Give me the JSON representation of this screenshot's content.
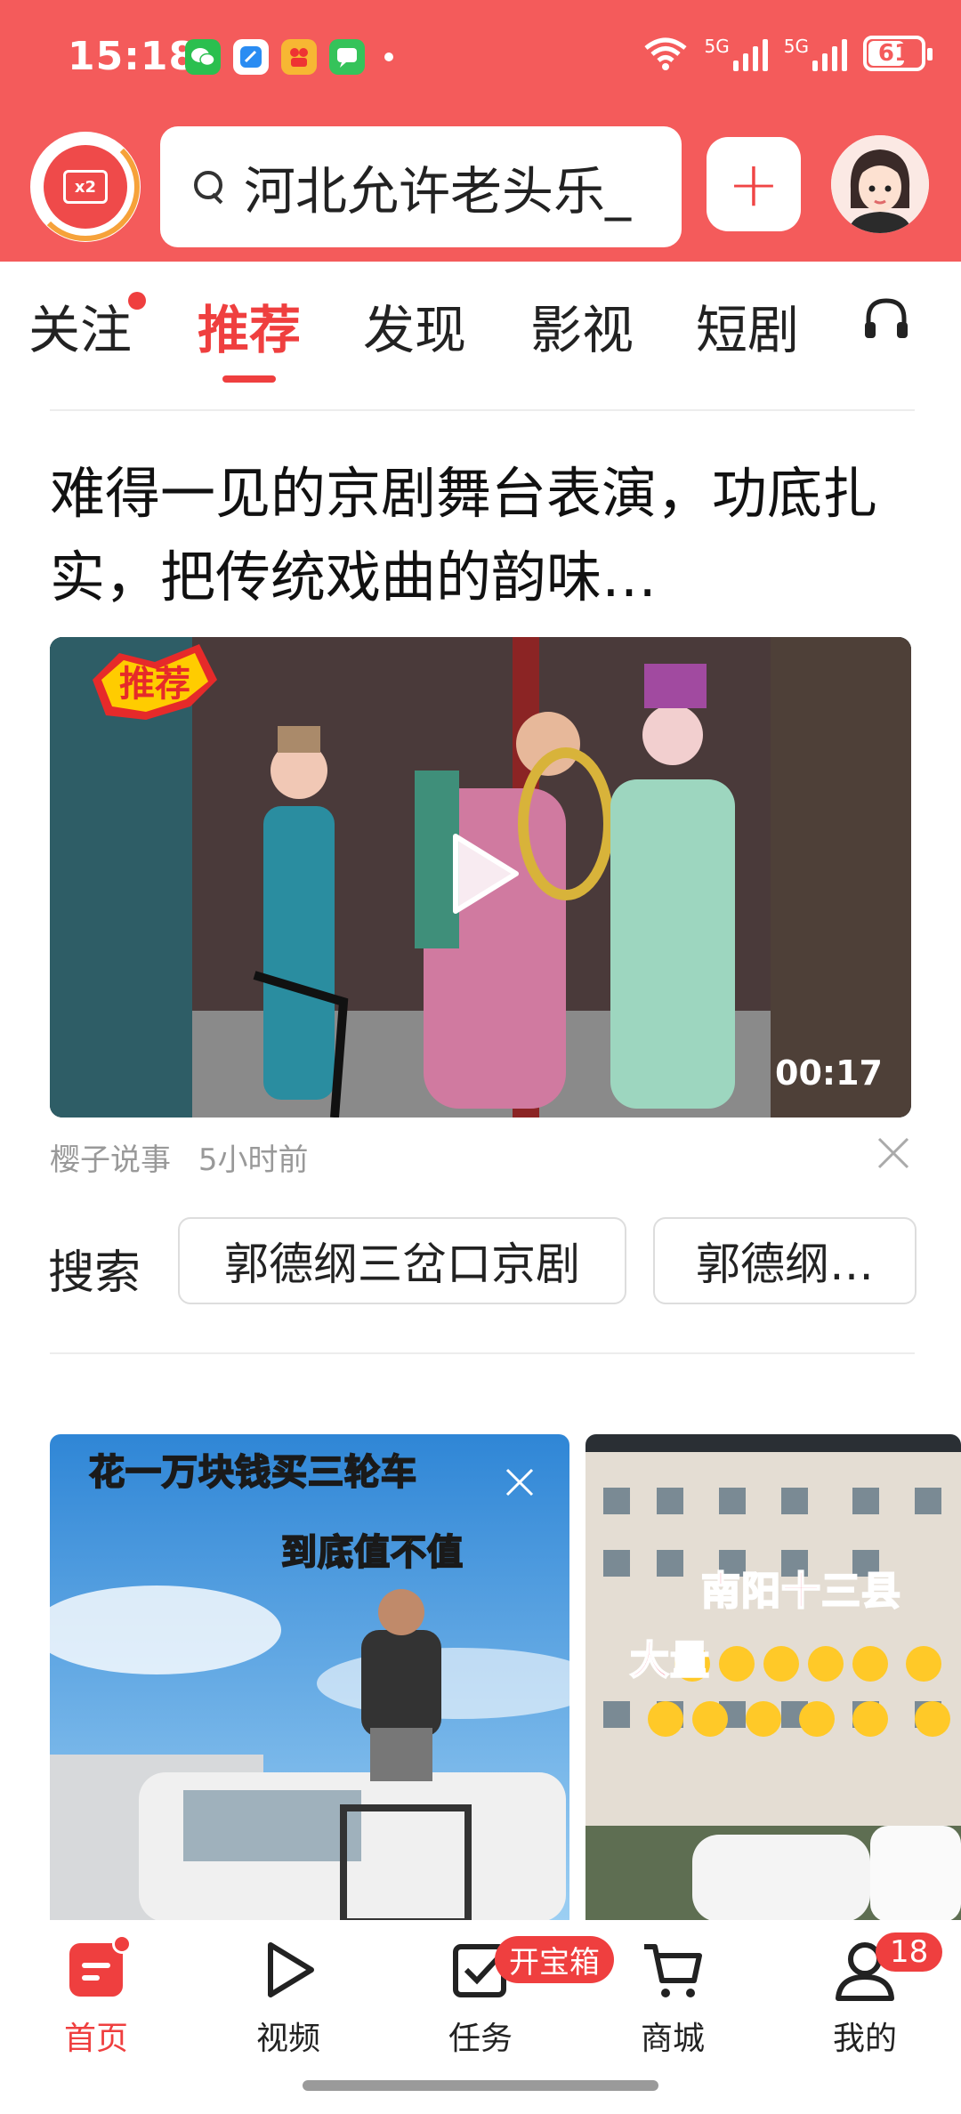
{
  "status": {
    "time": "15:18",
    "net1": "5G",
    "net2": "5G",
    "battery": "61"
  },
  "header": {
    "coin_label": "x2",
    "search_query": "河北允许老头乐_",
    "plus_label": "+"
  },
  "tabs": [
    {
      "label": "关注"
    },
    {
      "label": "推荐"
    },
    {
      "label": "发现"
    },
    {
      "label": "影视"
    },
    {
      "label": "短剧"
    }
  ],
  "article": {
    "title": "难得一见的京剧舞台表演，功底扎实，把传统戏曲的韵味…",
    "badge": "推荐",
    "duration": "00:17",
    "author": "樱子说事",
    "time_ago": "5小时前"
  },
  "related_search": {
    "label": "搜索",
    "chips": [
      "郭德纲三岔口京剧",
      "郭德纲…"
    ]
  },
  "cards": [
    {
      "caption1": "花一万块钱买三轮车",
      "caption2": "到底值不值"
    },
    {
      "caption1": "南阳十三县",
      "caption2": "大量"
    }
  ],
  "bottom_nav": [
    {
      "label": "首页"
    },
    {
      "label": "视频"
    },
    {
      "label": "任务",
      "badge": "开宝箱"
    },
    {
      "label": "商城"
    },
    {
      "label": "我的",
      "badge": "18"
    }
  ],
  "colors": {
    "brand_red": "#f45b5b",
    "accent_red": "#ef3f3f"
  }
}
